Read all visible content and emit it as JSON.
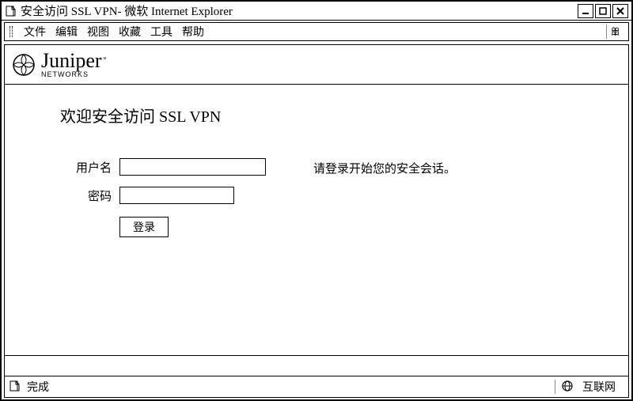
{
  "window": {
    "title": "安全访问 SSL VPN- 微软 Internet Explorer"
  },
  "menu": {
    "file": "文件",
    "edit": "编辑",
    "view": "视图",
    "favorites": "收藏",
    "tools": "工具",
    "help": "帮助"
  },
  "brand": {
    "name": "Juniper",
    "sub": "NETWORKS",
    "reg": "°"
  },
  "page": {
    "welcome": "欢迎安全访问 SSL VPN",
    "username_label": "用户名",
    "password_label": "密码",
    "username_value": "",
    "password_value": "",
    "login_hint": "请登录开始您的安全会话。",
    "login_button": "登录"
  },
  "status": {
    "done": "完成",
    "zone": "互联网"
  }
}
